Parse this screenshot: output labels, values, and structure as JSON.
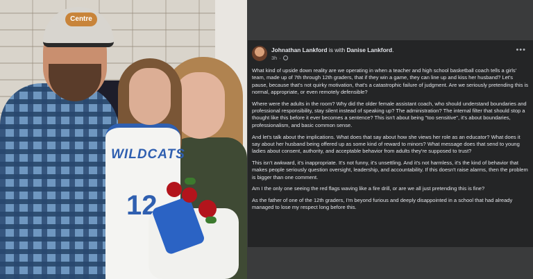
{
  "photo": {
    "cap_logo": "Centre",
    "jersey_text": "WILDCATS",
    "jersey_number": "12"
  },
  "post": {
    "author": "Johnathan Lankford",
    "with_text": "is with",
    "tagged": "Danise Lankford",
    "time": "3h",
    "more_icon": "•••",
    "paragraphs": [
      "What kind of upside down reality are we operating in when a teacher and high school basketball coach tells a girls' team, made up of 7th through 12th graders, that if they win a game, they can line up and kiss her husband? Let's pause, because that's not quirky motivation, that's a catastrophic failure of judgment. Are we seriously pretending this is normal, appropriate, or even remotely defensible?",
      "Where were the adults in the room? Why did the older female assistant coach, who should understand boundaries and professional responsibility, stay silent instead of speaking up? The administration? The internal filter that should stop a thought like this before it ever becomes a sentence? This isn't about being \"too sensitive\", it's about boundaries, professionalism, and basic common sense.",
      "And let's talk about the implications. What does that say about how she views her role as an educator? What does it say about her husband being offered up as some kind of reward to minors? What message does that send to young ladies about consent, authority, and acceptable behavior from adults they're supposed to trust?",
      "This isn't awkward, it's inappropriate. It's not funny, it's unsettling. And it's not harmless, it's the kind of behavior that makes people seriously question oversight, leadership, and accountability. If this doesn't raise alarms, then the problem is bigger than one comment.",
      "Am I the only one seeing the red flags waving like a fire drill, or are we all just pretending this is fine?",
      "As the father of one of the 12th graders, I'm beyond furious and deeply disappointed in a school that had already managed to lose my respect long before this."
    ]
  }
}
